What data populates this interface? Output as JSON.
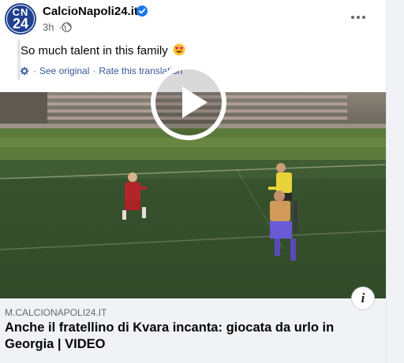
{
  "post": {
    "page_name": "CalcioNapoli24.it",
    "avatar_line1": "CN",
    "avatar_line2": "24",
    "time": "3h",
    "separator": "·",
    "message": "So much talent in this family",
    "see_original": "See original",
    "rate_translation": "Rate this translation",
    "link_separator": "·"
  },
  "link_preview": {
    "domain": "M.CALCIONAPOLI24.IT",
    "headline": "Anche il fratellino di Kvara incanta: giocata da urlo in Georgia | VIDEO",
    "info_label": "i"
  },
  "icons": {
    "verified": "verified-badge-icon",
    "globe": "globe-icon",
    "more": "more-options-icon",
    "gear": "gear-icon",
    "emoji": "heart-eyes-emoji-icon",
    "play": "play-icon",
    "info": "info-icon"
  },
  "colors": {
    "brand_blue": "#1877f2",
    "avatar_bg": "#1f3f8f",
    "link_blue": "#385898",
    "secondary_text": "#65676b",
    "link_box_bg": "#f0f2f5"
  }
}
